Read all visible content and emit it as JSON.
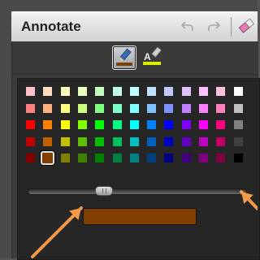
{
  "panel": {
    "title": "Annotate"
  },
  "toolbar": {
    "icons": [
      "undo-icon",
      "redo-icon",
      "eraser-icon"
    ]
  },
  "tools": [
    {
      "name": "pen-tool",
      "active": true
    },
    {
      "name": "highlighter-tool",
      "active": false
    }
  ],
  "palette": {
    "rows": [
      [
        "#ffc0c8",
        "#ffdcc0",
        "#ffffc0",
        "#e8ffc0",
        "#c0ffc0",
        "#c0ffe8",
        "#c0ffff",
        "#c0e0ff",
        "#c0c8ff",
        "#e0c0ff",
        "#ffc0ff",
        "#ffc0e0",
        "#ffffff"
      ],
      [
        "#ff7f7f",
        "#ffb07f",
        "#ffff7f",
        "#c8ff7f",
        "#7fff7f",
        "#7fffc8",
        "#7fffff",
        "#7fc0ff",
        "#7f8fff",
        "#c07fff",
        "#ff7fff",
        "#ff7fc0",
        "#c0c0c0"
      ],
      [
        "#ff0000",
        "#ff8000",
        "#ffff00",
        "#80ff00",
        "#00ff00",
        "#00ff80",
        "#00ffff",
        "#0080ff",
        "#0000ff",
        "#8000ff",
        "#ff00ff",
        "#ff0080",
        "#808080"
      ],
      [
        "#c00000",
        "#c06000",
        "#c0c000",
        "#60c000",
        "#00c000",
        "#00c060",
        "#00c0c0",
        "#0060c0",
        "#0000c0",
        "#6000c0",
        "#c000c0",
        "#c00060",
        "#404040"
      ],
      [
        "#800000",
        "#803f00",
        "#808000",
        "#408000",
        "#008000",
        "#008040",
        "#008080",
        "#004080",
        "#000080",
        "#400080",
        "#800080",
        "#800040",
        "#000000"
      ]
    ],
    "selected_color": "#803f00"
  },
  "thickness_slider": {
    "value_fraction": 0.33
  },
  "preview_color": "#803f00",
  "accent": {
    "arrow_color": "#f29a4a"
  }
}
